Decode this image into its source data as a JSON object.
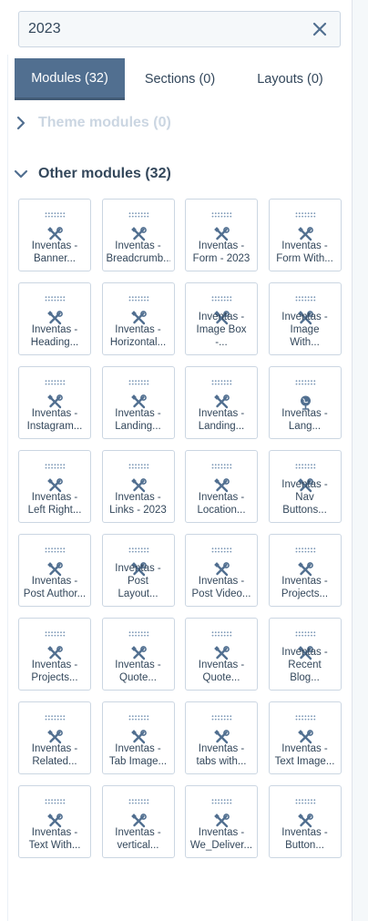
{
  "search": {
    "value": "2023",
    "clear_icon": "close-icon"
  },
  "tabs": [
    {
      "label": "Modules (32)",
      "active": true
    },
    {
      "label": "Sections (0)",
      "active": false
    },
    {
      "label": "Layouts (0)",
      "active": false
    }
  ],
  "sections": {
    "theme": {
      "label": "Theme modules (0)",
      "expanded": false
    },
    "other": {
      "label": "Other modules (32)",
      "expanded": true
    }
  },
  "colors": {
    "accent": "#516f90",
    "text": "#33475b",
    "border": "#cbd6e2",
    "muted": "#cbd6e2"
  },
  "modules": [
    {
      "label": "Inventas -\nBanner...",
      "icon": "wrench-icon"
    },
    {
      "label": "Inventas -\nBreadcrumb...",
      "icon": "wrench-icon"
    },
    {
      "label": "Inventas -\nForm - 2023",
      "icon": "wrench-icon"
    },
    {
      "label": "Inventas -\nForm With...",
      "icon": "wrench-icon"
    },
    {
      "label": "Inventas -\nHeading...",
      "icon": "wrench-icon"
    },
    {
      "label": "Inventas -\nHorizontal...",
      "icon": "wrench-icon"
    },
    {
      "label": "Inventas -\nImage Box\n-...",
      "icon": "wrench-icon"
    },
    {
      "label": "Inventas -\nImage\nWith...",
      "icon": "wrench-icon"
    },
    {
      "label": "Inventas -\nInstagram...",
      "icon": "wrench-icon"
    },
    {
      "label": "Inventas -\nLanding...",
      "icon": "wrench-icon"
    },
    {
      "label": "Inventas -\nLanding...",
      "icon": "wrench-icon"
    },
    {
      "label": "Inventas -\nLang...",
      "icon": "globe-icon"
    },
    {
      "label": "Inventas -\nLeft Right...",
      "icon": "wrench-icon"
    },
    {
      "label": "Inventas -\nLinks - 2023",
      "icon": "wrench-icon"
    },
    {
      "label": "Inventas -\nLocation...",
      "icon": "wrench-icon"
    },
    {
      "label": "Inventas -\nNav\nButtons...",
      "icon": "wrench-icon"
    },
    {
      "label": "Inventas -\nPost Author...",
      "icon": "wrench-icon"
    },
    {
      "label": "Inventas -\nPost\nLayout...",
      "icon": "wrench-icon"
    },
    {
      "label": "Inventas -\nPost Video...",
      "icon": "wrench-icon"
    },
    {
      "label": "Inventas -\nProjects...",
      "icon": "wrench-icon"
    },
    {
      "label": "Inventas -\nProjects...",
      "icon": "wrench-icon"
    },
    {
      "label": "Inventas -\nQuote...",
      "icon": "wrench-icon"
    },
    {
      "label": "Inventas -\nQuote...",
      "icon": "wrench-icon"
    },
    {
      "label": "Inventas -\nRecent\nBlog...",
      "icon": "wrench-icon"
    },
    {
      "label": "Inventas -\nRelated...",
      "icon": "wrench-icon"
    },
    {
      "label": "Inventas -\nTab Image...",
      "icon": "wrench-icon"
    },
    {
      "label": "Inventas -\ntabs with...",
      "icon": "wrench-icon"
    },
    {
      "label": "Inventas -\nText Image...",
      "icon": "wrench-icon"
    },
    {
      "label": "Inventas -\nText With...",
      "icon": "wrench-icon"
    },
    {
      "label": "Inventas -\nvertical...",
      "icon": "wrench-icon"
    },
    {
      "label": "Inventas -\nWe_Deliver...",
      "icon": "wrench-icon"
    },
    {
      "label": "Inventas -\nButton...",
      "icon": "wrench-icon"
    }
  ]
}
